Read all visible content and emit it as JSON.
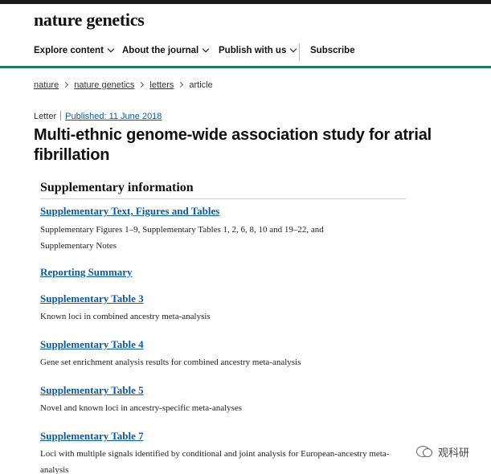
{
  "masthead": {
    "title": "nature genetics"
  },
  "nav": {
    "items": [
      {
        "label": "Explore content"
      },
      {
        "label": "About the journal"
      },
      {
        "label": "Publish with us"
      },
      {
        "label": "Subscribe"
      }
    ],
    "accent_color": "#1e7a5a"
  },
  "breadcrumb": {
    "items": [
      "nature",
      "nature genetics",
      "letters"
    ],
    "current": "article"
  },
  "article": {
    "type": "Letter",
    "published": "Published: 11 June 2018",
    "title": "Multi-ethnic genome-wide association study for atrial fibrillation"
  },
  "supplementary": {
    "heading": "Supplementary information",
    "items": [
      {
        "title": "Supplementary Text, Figures and Tables",
        "description": "Supplementary Figures 1–9, Supplementary Tables 1, 2, 6, 8, 10 and 19–22, and Supplementary Notes"
      },
      {
        "title": "Reporting Summary",
        "description": ""
      },
      {
        "title": "Supplementary Table 3",
        "description": "Known loci in combined ancestry meta-analysis"
      },
      {
        "title": "Supplementary Table 4",
        "description": "Gene set enrichment analysis results for combined ancestry meta-analysis"
      },
      {
        "title": "Supplementary Table 5",
        "description": "Novel and known loci in ancestry-specific meta-analyses"
      },
      {
        "title": "Supplementary Table 7",
        "description": "Loci with multiple signals identified by conditional and joint analysis for European-ancestry meta-analysis"
      }
    ],
    "link_color": "#0b5aa2"
  },
  "watermark": {
    "text": "观科研",
    "icon": "wechat-icon"
  }
}
